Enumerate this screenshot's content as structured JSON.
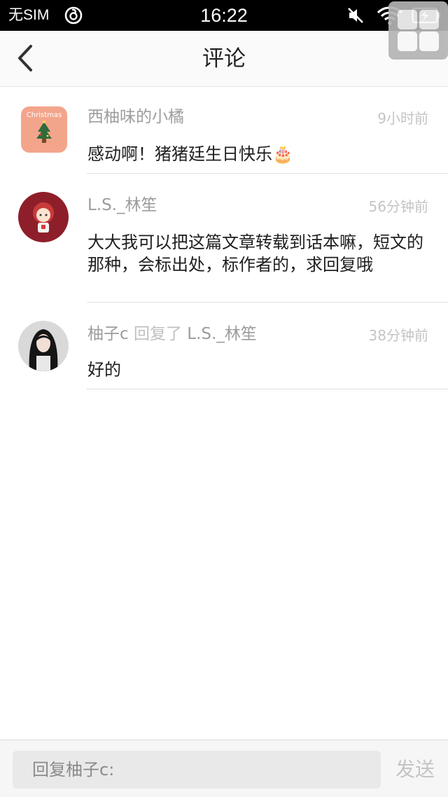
{
  "status_bar": {
    "carrier": "无SIM",
    "time": "16:22",
    "icons": [
      "netease-music-icon",
      "mute-icon",
      "wifi-icon",
      "battery-charging-icon"
    ]
  },
  "nav": {
    "title": "评论",
    "back_icon": "chevron-left-icon",
    "menu_icon": "grid-icon"
  },
  "comments": [
    {
      "username": "西柚味的小橘",
      "reply_word": "",
      "reply_to": "",
      "time": "9小时前",
      "text": "感动啊！猪猪廷生日快乐🎂",
      "avatar_text": "Christmas",
      "avatar_color": "#f3a58c"
    },
    {
      "username": "L.S._林笙",
      "reply_word": "",
      "reply_to": "",
      "time": "56分钟前",
      "text": "大大我可以把这篇文章转载到话本嘛，短文的那种，会标出处，标作者的，求回复哦",
      "avatar_color": "#8e1f2a"
    },
    {
      "username": "柚子c",
      "reply_word": "回复了",
      "reply_to": "L.S._林笙",
      "time": "38分钟前",
      "text": "好的",
      "avatar_color": "#d9d9d9"
    }
  ],
  "reply_bar": {
    "placeholder": "回复柚子c:",
    "send_label": "发送"
  },
  "colors": {
    "status_bar_bg": "#000000",
    "nav_bg": "#fafafa",
    "meta_text": "#9c9c9c",
    "body_text": "#1e1e1e",
    "send_disabled": "#c4c4c4"
  }
}
